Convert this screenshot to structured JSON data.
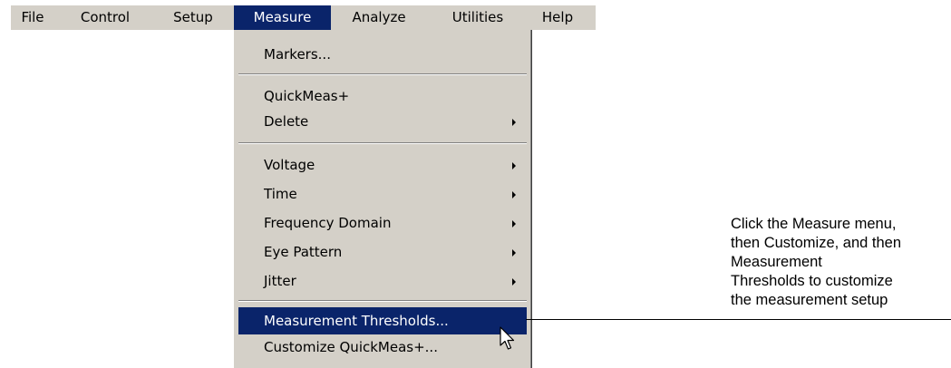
{
  "menubar": {
    "items": [
      {
        "label": "File"
      },
      {
        "label": "Control"
      },
      {
        "label": "Setup"
      },
      {
        "label": "Measure",
        "active": true
      },
      {
        "label": "Analyze"
      },
      {
        "label": "Utilities"
      },
      {
        "label": "Help"
      }
    ]
  },
  "measure_menu": {
    "markers": "Markers...",
    "quickmeas": "QuickMeas+",
    "delete": "Delete",
    "voltage": "Voltage",
    "time": "Time",
    "frequency_domain": "Frequency Domain",
    "eye_pattern": "Eye Pattern",
    "jitter": "Jitter",
    "measurement_thresholds": "Measurement Thresholds...",
    "customize_quickmeas": "Customize QuickMeas+..."
  },
  "colors": {
    "menu_background": "#d4d0c8",
    "highlight": "#0a246a",
    "highlight_text": "#ffffff"
  },
  "icons": {
    "submenu_arrow": "chevron-right-icon",
    "pointer": "mouse-pointer-icon"
  },
  "callout": {
    "text": "Click the Measure menu,\nthen Customize, and then\nMeasurement\nThresholds to customize\nthe measurement setup"
  }
}
